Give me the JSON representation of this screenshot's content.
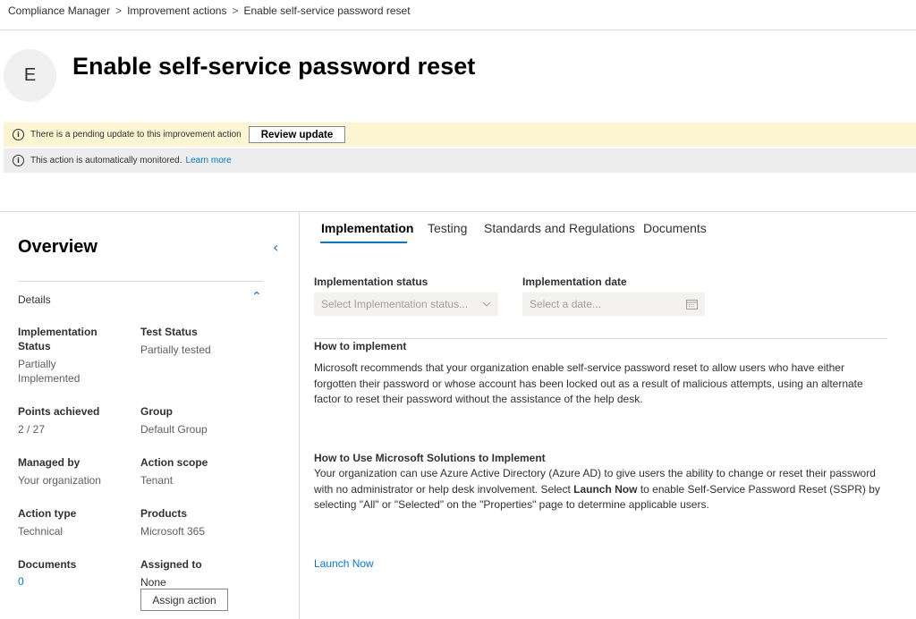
{
  "breadcrumb": {
    "items": [
      "Compliance Manager",
      "Improvement actions",
      "Enable self-service password reset"
    ],
    "separator": ">"
  },
  "header": {
    "avatar_letter": "E",
    "title": "Enable self-service password reset"
  },
  "banners": {
    "pending_text": "There is a pending update to this improvement action",
    "review_label": "Review update",
    "monitored_text": "This action is automatically monitored.",
    "learn_more": "Learn more",
    "info_icon": "info-icon"
  },
  "overview": {
    "title": "Overview",
    "collapse_glyph": "‹",
    "details_label": "Details",
    "fields": {
      "implementation_status_label": "Implementation Status",
      "implementation_status_value": "Partially Implemented",
      "test_status_label": "Test Status",
      "test_status_value": "Partially tested",
      "points_label": "Points achieved",
      "points_value": "2 / 27",
      "group_label": "Group",
      "group_value": "Default Group",
      "managed_by_label": "Managed by",
      "managed_by_value": "Your organization",
      "action_scope_label": "Action scope",
      "action_scope_value": "Tenant",
      "action_type_label": "Action type",
      "action_type_value": "Technical",
      "products_label": "Products",
      "products_value": "Microsoft 365",
      "documents_label": "Documents",
      "documents_value": "0",
      "assigned_to_label": "Assigned to",
      "assigned_to_value": "None"
    },
    "assign_button": "Assign action"
  },
  "tabs": [
    "Implementation",
    "Testing",
    "Standards and Regulations",
    "Documents"
  ],
  "implementation": {
    "status_label": "Implementation status",
    "status_placeholder": "Select Implementation status...",
    "date_label": "Implementation date",
    "date_placeholder": "Select a date...",
    "how_to_heading": "How to implement",
    "how_to_text": "Microsoft recommends that your organization enable self-service password reset to allow users who have either forgotten their password or whose account has been locked out as a result of malicious attempts, using an alternate factor to reset their password without the assistance of the help desk.",
    "ms_heading": "How to Use Microsoft Solutions to Implement",
    "ms_text_before": "Your organization can use Azure Active Directory (Azure AD) to give users the ability to change or reset their password with no administrator or help desk involvement. Select ",
    "ms_text_bold": "Launch Now",
    "ms_text_after": " to enable Self-Service Password Reset (SSPR) by selecting \"All\" or \"Selected\" on the \"Properties\" page to determine applicable users.",
    "launch_link": "Launch Now"
  },
  "colors": {
    "accent": "#0078d4",
    "pending_banner": "#fdf4d2",
    "monitored_banner": "#ededed"
  }
}
